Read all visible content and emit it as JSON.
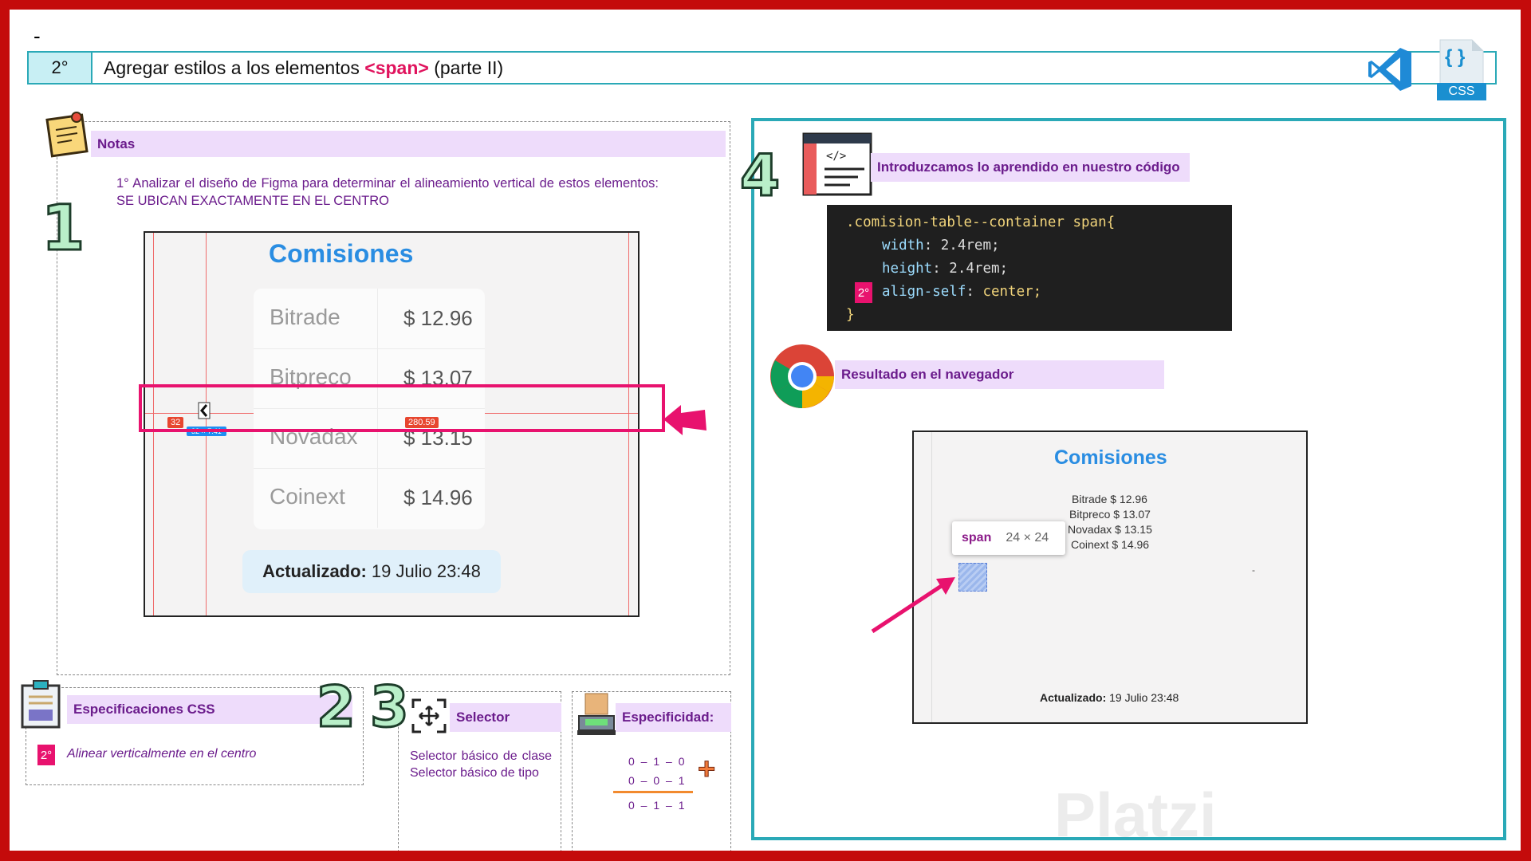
{
  "header": {
    "dash": "-",
    "step": "2°",
    "title_before": "Agregar estilos a los elementos ",
    "title_tag": "<span>",
    "title_after": " (parte II)",
    "css_badge": "CSS",
    "css_braces": "{ }"
  },
  "notes": {
    "label": "Notas",
    "number": "1",
    "text": "1° Analizar el diseño de Figma para determinar el alineamiento vertical de estos elementos: SE UBICAN EXACTAMENTE EN EL CENTRO"
  },
  "figma": {
    "title": "Comisiones",
    "rows": [
      {
        "name": "Bitrade",
        "value": "$ 12.96"
      },
      {
        "name": "Bitpreco",
        "value": "$ 13.07"
      },
      {
        "name": "Novadax",
        "value": "$ 13.15"
      },
      {
        "name": "Coinext",
        "value": "$ 14.96"
      }
    ],
    "updated_label": "Actualizado:",
    "updated_value": "19 Julio 23:48",
    "measure_left": "32",
    "measure_right": "280.59",
    "measure_size": "32 × 7.41"
  },
  "specs": {
    "label": "Especificaciones CSS",
    "badge": "2°",
    "text": "Alinear verticalmente en el centro",
    "number": "2"
  },
  "selector": {
    "number": "3",
    "label": "Selector",
    "text": "Selector básico de clase Selector básico de tipo"
  },
  "specificity": {
    "label": "Especificidad:",
    "line1": "0 – 1 – 0",
    "line2": "0 – 0 – 1",
    "line3": "0 – 1 – 1",
    "plus": "+"
  },
  "code_section": {
    "number": "4",
    "label": "Introduzcamos lo aprendido en nuestro código",
    "selector": ".comision-table--container span{",
    "lines": [
      {
        "prop": "width",
        "value": " 2.4rem;"
      },
      {
        "prop": "height",
        "value": " 2.4rem;"
      },
      {
        "prop": "align-self",
        "value": " center;"
      }
    ],
    "closing": "}",
    "badge": "2°"
  },
  "browser_section": {
    "label": "Resultado en el navegador",
    "title": "Comisiones",
    "rows": [
      "Bitrade  $ 12.96",
      "Bitpreco $ 13.07",
      "Novadax $ 13.15",
      "Coinext  $ 14.96"
    ],
    "tooltip_tag": "span",
    "tooltip_size": "24 × 24",
    "updated_label": "Actualizado:",
    "updated_value": "19 Julio 23:48",
    "dash": "-"
  },
  "watermark": "Platzi",
  "colors": {
    "frame": "#c40b0b",
    "teal": "#2aa9b7",
    "pink": "#e8126e",
    "purple_text": "#6b1c8c",
    "band": "#eedcfb"
  }
}
